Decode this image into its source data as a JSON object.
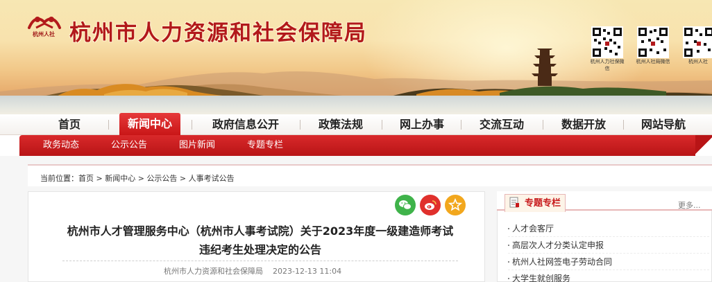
{
  "header": {
    "logo_caption": "杭州人社",
    "site_title": "杭州市人力资源和社会保障局",
    "qr_codes": [
      {
        "caption": "杭州人力社保微信"
      },
      {
        "caption": "杭州人社局微信"
      },
      {
        "caption": "杭州人社"
      }
    ]
  },
  "main_nav": {
    "items": [
      "首页",
      "新闻中心",
      "政府信息公开",
      "政策法规",
      "网上办事",
      "交流互动",
      "数据开放",
      "网站导航"
    ],
    "active": "新闻中心"
  },
  "sub_nav": {
    "items": [
      "政务动态",
      "公示公告",
      "图片新闻",
      "专题专栏"
    ]
  },
  "breadcrumb": {
    "prefix": "当前位置：",
    "items": [
      "首页",
      "新闻中心",
      "公示公告",
      "人事考试公告"
    ],
    "separator": " > "
  },
  "article": {
    "title": "杭州市人才管理服务中心（杭州市人事考试院）关于2023年度一级建造师考试违纪考生处理决定的公告",
    "publisher": "杭州市人力资源和社会保障局",
    "date": "2023-12-13 11:04",
    "share_icons": [
      "wechat-icon",
      "weibo-icon",
      "favorite-icon"
    ],
    "colors": {
      "wechat": "#3fb34a",
      "weibo": "#e0302c",
      "favorite": "#f2a71d"
    }
  },
  "sidebar": {
    "heading": "专题专栏",
    "more": "更多...",
    "items": [
      "人才会客厅",
      "高层次人才分类认定申报",
      "杭州人社网签电子劳动合同",
      "大学生就创服务"
    ]
  },
  "colors": {
    "brand_red": "#c91617",
    "title_red": "#b2191b"
  }
}
